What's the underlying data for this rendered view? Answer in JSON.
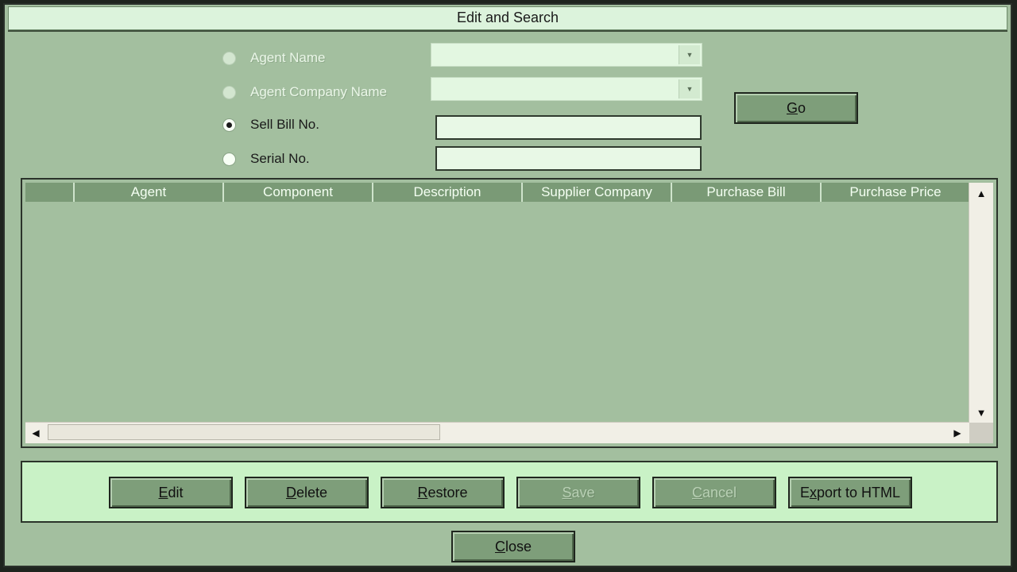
{
  "window": {
    "title": "Edit and Search"
  },
  "search": {
    "options": [
      {
        "label": "Agent Name",
        "selected": false,
        "enabled": false
      },
      {
        "label": "Agent Company Name",
        "selected": false,
        "enabled": false
      },
      {
        "label": "Sell Bill No.",
        "selected": true,
        "enabled": true
      },
      {
        "label": "Serial No.",
        "selected": false,
        "enabled": true
      }
    ],
    "agent_name_value": "",
    "agent_company_value": "",
    "sell_bill_value": "",
    "serial_value": "",
    "go_button": {
      "prefix": "",
      "mnemonic": "G",
      "suffix": "o"
    }
  },
  "grid": {
    "columns": [
      "",
      "Agent",
      "Component",
      "Description",
      "Supplier Company",
      "Purchase Bill",
      "Purchase Price"
    ],
    "rows": []
  },
  "actions": {
    "edit": {
      "prefix": "",
      "mnemonic": "E",
      "suffix": "dit",
      "enabled": true
    },
    "delete": {
      "prefix": "",
      "mnemonic": "D",
      "suffix": "elete",
      "enabled": true
    },
    "restore": {
      "prefix": "",
      "mnemonic": "R",
      "suffix": "estore",
      "enabled": true
    },
    "save": {
      "prefix": "",
      "mnemonic": "S",
      "suffix": "ave",
      "enabled": false
    },
    "cancel": {
      "prefix": "",
      "mnemonic": "C",
      "suffix": "ancel",
      "enabled": false
    },
    "export": {
      "prefix": "E",
      "mnemonic": "x",
      "suffix": "port to HTML",
      "enabled": true
    }
  },
  "close_button": {
    "prefix": "",
    "mnemonic": "C",
    "suffix": "lose"
  },
  "colors": {
    "window_bg": "#a3bf9f",
    "title_bg": "#dcf3dc",
    "button_bg": "#7e9e7a",
    "header_bg": "#7a9a76",
    "panel_bg": "#c9f2c6"
  },
  "icons": {
    "dropdown": "chevron-down-icon",
    "scroll_up": "arrow-up-icon",
    "scroll_down": "arrow-down-icon",
    "scroll_left": "arrow-left-icon",
    "scroll_right": "arrow-right-icon"
  }
}
